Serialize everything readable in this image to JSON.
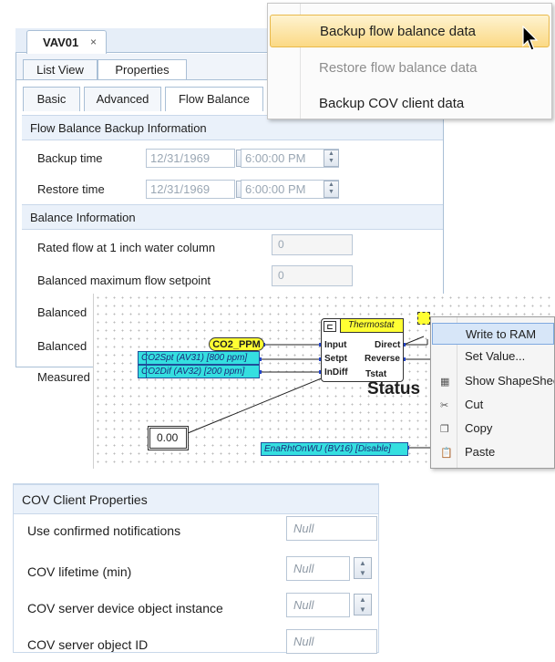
{
  "doc_tab": {
    "label": "VAV01",
    "close_glyph": "×"
  },
  "view_tabs": [
    "List View",
    "Properties"
  ],
  "sub_tabs": [
    "Basic",
    "Advanced",
    "Flow Balance"
  ],
  "backup_section": {
    "header": "Flow Balance Backup Information",
    "rows": [
      {
        "label": "Backup time",
        "date": "12/31/1969",
        "time": "6:00:00 PM"
      },
      {
        "label": "Restore time",
        "date": "12/31/1969",
        "time": "6:00:00 PM"
      }
    ]
  },
  "balance_section": {
    "header": "Balance Information",
    "rows": [
      {
        "label": "Rated flow at 1 inch water column",
        "value": "0"
      },
      {
        "label": "Balanced maximum flow setpoint",
        "value": "0"
      },
      {
        "label": "Balanced",
        "value": ""
      },
      {
        "label": "Balanced",
        "value": ""
      },
      {
        "label": "Measured",
        "value": ""
      }
    ]
  },
  "menu_top": {
    "items": [
      {
        "label": "Backup flow balance data",
        "state": "highlighted"
      },
      {
        "label": "Restore flow balance data",
        "state": "disabled"
      },
      {
        "label": "Backup COV client data",
        "state": "normal"
      }
    ]
  },
  "diagram": {
    "co2_label": "CO2_PPM",
    "co2spt": "CO2Spt (AV31) [800 ppm]",
    "co2dif": "CO2Dif (AV32) [200 ppm]",
    "block_title": "Thermostat",
    "block_name": "Tstat",
    "inputs": [
      "Input",
      "Setpt",
      "InDiff"
    ],
    "outputs": [
      "Direct",
      "Reverse"
    ],
    "status_label": "Status",
    "value_box": "0.00",
    "enarht": "EnaRhtOnWU (BV16) [Disable]"
  },
  "menu_diagram": {
    "items": [
      {
        "label": "Write to RAM",
        "icon": "",
        "state": "highlighted"
      },
      {
        "label": "Set Value...",
        "icon": "",
        "state": "normal"
      },
      {
        "label": "Show ShapeSheet",
        "icon": "shapesheet-icon",
        "state": "normal"
      },
      {
        "label": "Cut",
        "icon": "scissors-icon",
        "state": "normal"
      },
      {
        "label": "Copy",
        "icon": "copy-icon",
        "state": "normal"
      },
      {
        "label": "Paste",
        "icon": "paste-icon",
        "state": "normal"
      }
    ]
  },
  "cov_section": {
    "header": "COV Client Properties",
    "rows": [
      {
        "label": "Use confirmed notifications",
        "value": "Null"
      },
      {
        "label": "COV lifetime (min)",
        "value": "Null"
      },
      {
        "label": "COV server device object instance",
        "value": "Null"
      },
      {
        "label": "COV server object ID",
        "value": "Null"
      }
    ]
  }
}
